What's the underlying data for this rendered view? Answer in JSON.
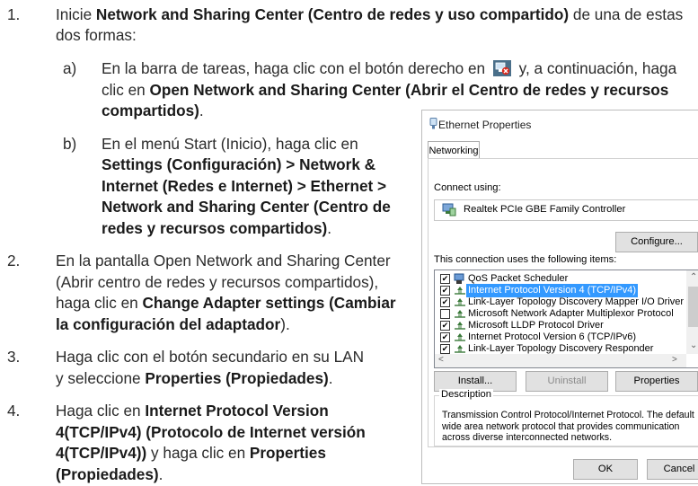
{
  "steps": [
    {
      "num": "1.",
      "lines": [
        {
          "parts": [
            {
              "t": "Inicie "
            },
            {
              "b": "Network and Sharing Center (Centro de redes y uso compartido)"
            },
            {
              "t": " de una de estas"
            }
          ]
        },
        {
          "parts": [
            {
              "t": "dos formas:"
            }
          ]
        }
      ]
    },
    {
      "num": "2.",
      "lines": [
        {
          "parts": [
            {
              "t": "En la pantalla Open Network and Sharing Center"
            }
          ]
        },
        {
          "parts": [
            {
              "t": "(Abrir centro de redes y recursos compartidos),"
            }
          ]
        },
        {
          "parts": [
            {
              "t": "haga clic en "
            },
            {
              "b": "Change Adapter settings (Cambiar"
            }
          ]
        },
        {
          "parts": [
            {
              "b": "la configuración del adaptador"
            },
            {
              "t": ")."
            }
          ]
        }
      ]
    },
    {
      "num": "3.",
      "lines": [
        {
          "parts": [
            {
              "t": "Haga clic con el botón secundario en su LAN"
            }
          ]
        },
        {
          "parts": [
            {
              "t": "y seleccione "
            },
            {
              "b": "Properties (Propiedades)"
            },
            {
              "t": "."
            }
          ]
        }
      ]
    },
    {
      "num": "4.",
      "lines": [
        {
          "parts": [
            {
              "t": "Haga clic en "
            },
            {
              "b": "Internet Protocol Version"
            }
          ]
        },
        {
          "parts": [
            {
              "b": "4(TCP/IPv4) (Protocolo de Internet versión"
            }
          ]
        },
        {
          "parts": [
            {
              "b": "4(TCP/IPv4))"
            },
            {
              "t": " y haga clic en "
            },
            {
              "b": "Properties"
            }
          ]
        },
        {
          "parts": [
            {
              "b": "(Propiedades)"
            },
            {
              "t": "."
            }
          ]
        }
      ]
    }
  ],
  "substeps": [
    {
      "letter": "a)",
      "lines": [
        {
          "parts": [
            {
              "t": "En la barra de tareas, haga clic con el botón derecho en "
            },
            {
              "icon": "network-tray-icon"
            },
            {
              "t": " y, a continuación, haga"
            }
          ]
        },
        {
          "parts": [
            {
              "t": "clic en "
            },
            {
              "b": "Open Network and Sharing Center (Abrir el Centro de redes y recursos"
            }
          ]
        },
        {
          "parts": [
            {
              "b": "compartidos)"
            },
            {
              "t": "."
            }
          ]
        }
      ]
    },
    {
      "letter": "b)",
      "lines": [
        {
          "parts": [
            {
              "t": "En el menú Start (Inicio), haga clic en"
            }
          ]
        },
        {
          "parts": [
            {
              "b": "Settings (Configuración) > Network &"
            }
          ]
        },
        {
          "parts": [
            {
              "b": "Internet (Redes e Internet) > Ethernet >"
            }
          ]
        },
        {
          "parts": [
            {
              "b": "Network and Sharing Center (Centro de"
            }
          ]
        },
        {
          "parts": [
            {
              "b": "redes y recursos compartidos)"
            },
            {
              "t": "."
            }
          ]
        }
      ]
    }
  ],
  "dialog": {
    "title": "Ethernet Properties",
    "tab": "Networking",
    "connect_using_label": "Connect using:",
    "adapter": "Realtek PCIe GBE Family Controller",
    "configure_button": "Configure...",
    "items_label": "This connection uses the following items:",
    "items": [
      {
        "label": "QoS Packet Scheduler",
        "checked": true,
        "selected": false,
        "icon": "qos-icon"
      },
      {
        "label": "Internet Protocol Version 4 (TCP/IPv4)",
        "checked": true,
        "selected": true,
        "icon": "protocol-icon"
      },
      {
        "label": "Link-Layer Topology Discovery Mapper I/O Driver",
        "checked": true,
        "selected": false,
        "icon": "protocol-icon"
      },
      {
        "label": "Microsoft Network Adapter Multiplexor Protocol",
        "checked": false,
        "selected": false,
        "icon": "protocol-icon"
      },
      {
        "label": "Microsoft LLDP Protocol Driver",
        "checked": true,
        "selected": false,
        "icon": "protocol-icon"
      },
      {
        "label": "Internet Protocol Version 6 (TCP/IPv6)",
        "checked": true,
        "selected": false,
        "icon": "protocol-icon"
      },
      {
        "label": "Link-Layer Topology Discovery Responder",
        "checked": true,
        "selected": false,
        "icon": "protocol-icon"
      }
    ],
    "install_button": "Install...",
    "uninstall_button": "Uninstall",
    "properties_button": "Properties",
    "description_label": "Description",
    "description_text": "Transmission Control Protocol/Internet Protocol. The default wide area network protocol that provides communication across diverse interconnected networks.",
    "ok_button": "OK",
    "cancel_button": "Cancel"
  },
  "colors": {
    "selection": "#3399ff",
    "text": "#2b2b2b"
  }
}
